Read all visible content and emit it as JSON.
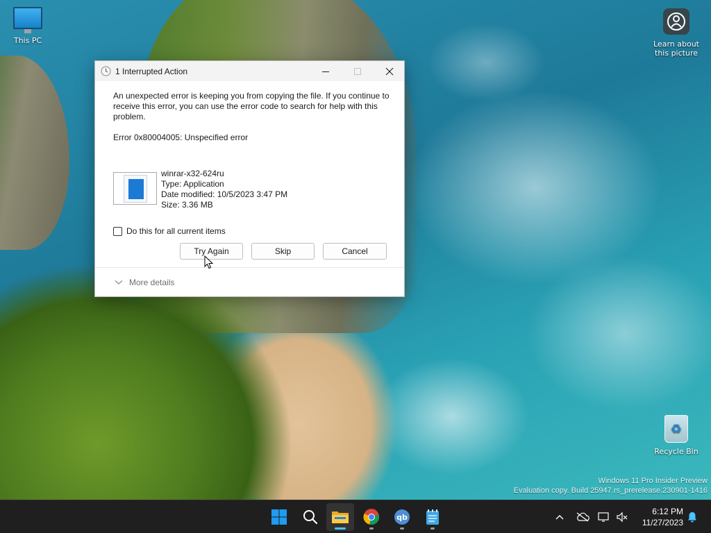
{
  "desktop": {
    "icons": {
      "this_pc": "This PC",
      "learn_line1": "Learn about",
      "learn_line2": "this picture",
      "recycle_bin": "Recycle Bin"
    },
    "watermark": {
      "line1": "Windows 11 Pro Insider Preview",
      "line2": "Evaluation copy. Build 25947.rs_prerelease.230901-1416"
    }
  },
  "dialog": {
    "title": "1 Interrupted Action",
    "message": "An unexpected error is keeping you from copying the file. If you continue to receive this error, you can use the error code to search for help with this problem.",
    "error_code": "Error 0x80004005: Unspecified error",
    "file": {
      "name": "winrar-x32-624ru",
      "type": "Type: Application",
      "date_modified": "Date modified: 10/5/2023 3:47 PM",
      "size": "Size: 3.36 MB"
    },
    "checkbox_label": "Do this for all current items",
    "checkbox_checked": false,
    "buttons": {
      "try_again": "Try Again",
      "skip": "Skip",
      "cancel": "Cancel"
    },
    "more_details": "More details",
    "window_controls": [
      "minimize-icon",
      "maximize-icon",
      "close-icon"
    ]
  },
  "taskbar": {
    "apps": [
      {
        "name": "start",
        "icon": "windows-logo-icon"
      },
      {
        "name": "search",
        "icon": "search-icon"
      },
      {
        "name": "file-explorer",
        "icon": "folder-icon",
        "active": true
      },
      {
        "name": "chrome",
        "icon": "chrome-icon"
      },
      {
        "name": "qbittorrent",
        "icon": "qbittorrent-icon",
        "label": "qb"
      },
      {
        "name": "notepad",
        "icon": "notepad-icon"
      }
    ],
    "clock": {
      "time": "6:12 PM",
      "date": "11/27/2023"
    },
    "colors": {
      "taskbar_bg": "#1f1f1f",
      "accent": "#4cc2ff",
      "start_blue": "#0078d4"
    }
  }
}
